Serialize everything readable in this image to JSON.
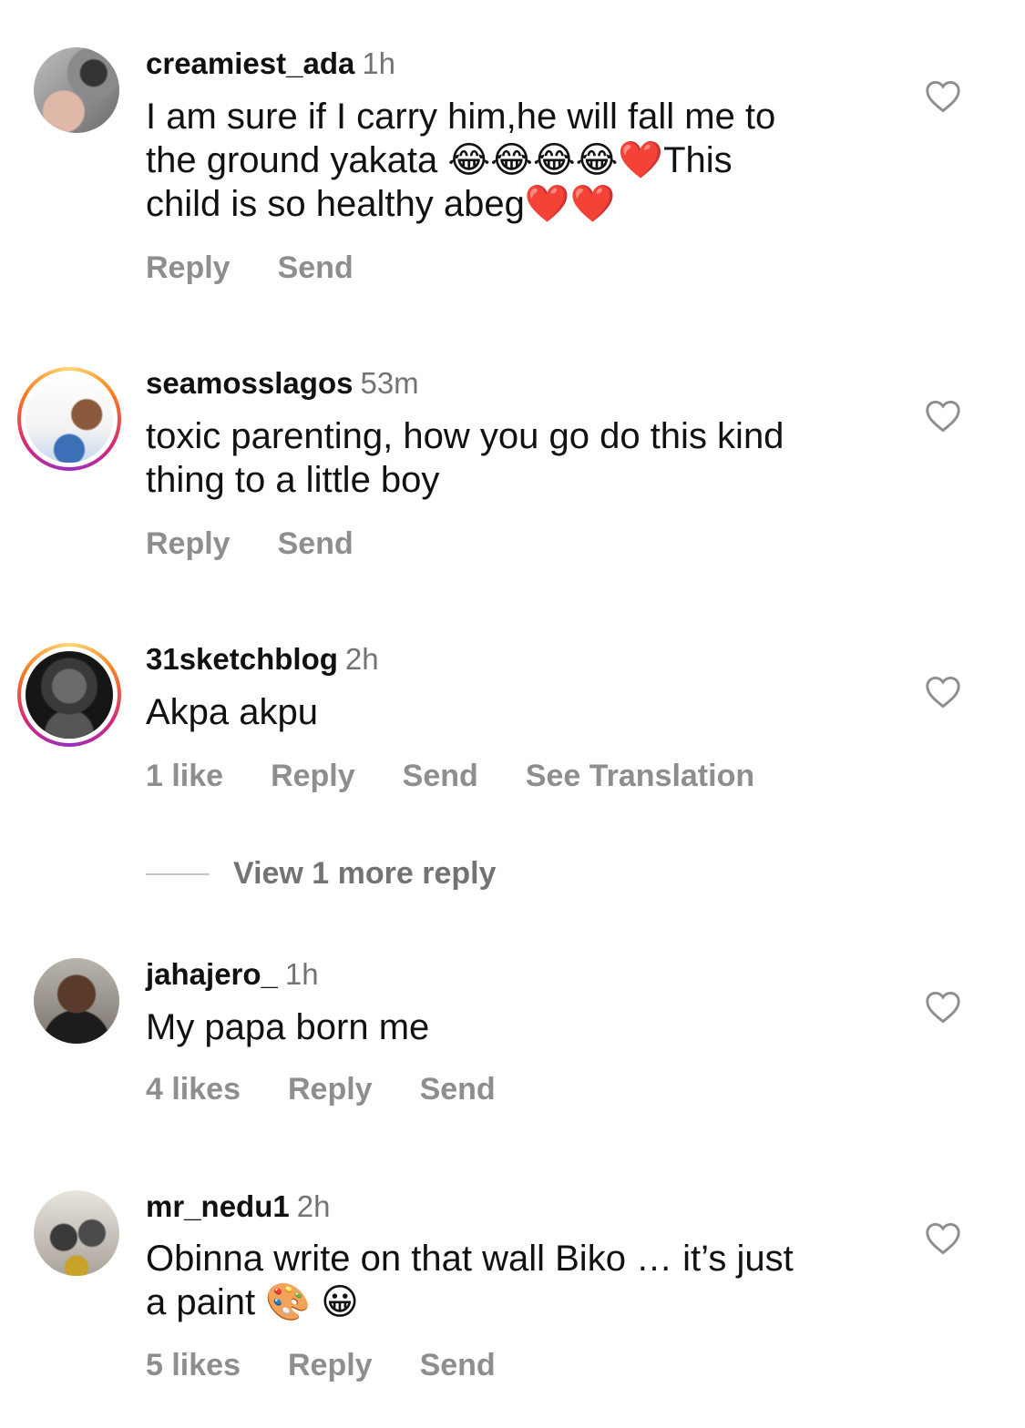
{
  "comments": [
    {
      "username": "creamiest_ada",
      "time": "1h",
      "text_line1": "I am sure if I carry him,he will fall me to",
      "text_line2": "the ground yakata 😂😂😂😂❤️This",
      "text_line3": "child is so healthy abeg❤️❤️",
      "actions": [
        "Reply",
        "Send"
      ]
    },
    {
      "username": "seamosslagos",
      "time": "53m",
      "text_line1": "toxic parenting, how you go do this kind",
      "text_line2": "thing to a little boy",
      "actions": [
        "Reply",
        "Send"
      ]
    },
    {
      "username": "31sketchblog",
      "time": "2h",
      "text_line1": "Akpa akpu",
      "actions": [
        "1 like",
        "Reply",
        "Send",
        "See Translation"
      ],
      "view_more": "View 1 more reply"
    },
    {
      "username": "jahajero_",
      "time": "1h",
      "text_line1": "My papa born me",
      "actions": [
        "4 likes",
        "Reply",
        "Send"
      ]
    },
    {
      "username": "mr_nedu1",
      "time": "2h",
      "text_line1": "Obinna write on that wall Biko … it’s just",
      "text_line2": "a paint 🎨 😀",
      "actions": [
        "5 likes",
        "Reply",
        "Send"
      ]
    }
  ],
  "colors": {
    "username": "#111111",
    "muted": "#737373",
    "action": "#8e8e8e",
    "story_ring": [
      "#feda75",
      "#fa7e1e",
      "#d62976",
      "#962fbf"
    ]
  },
  "icons": {
    "like": "heart-outline-icon"
  }
}
